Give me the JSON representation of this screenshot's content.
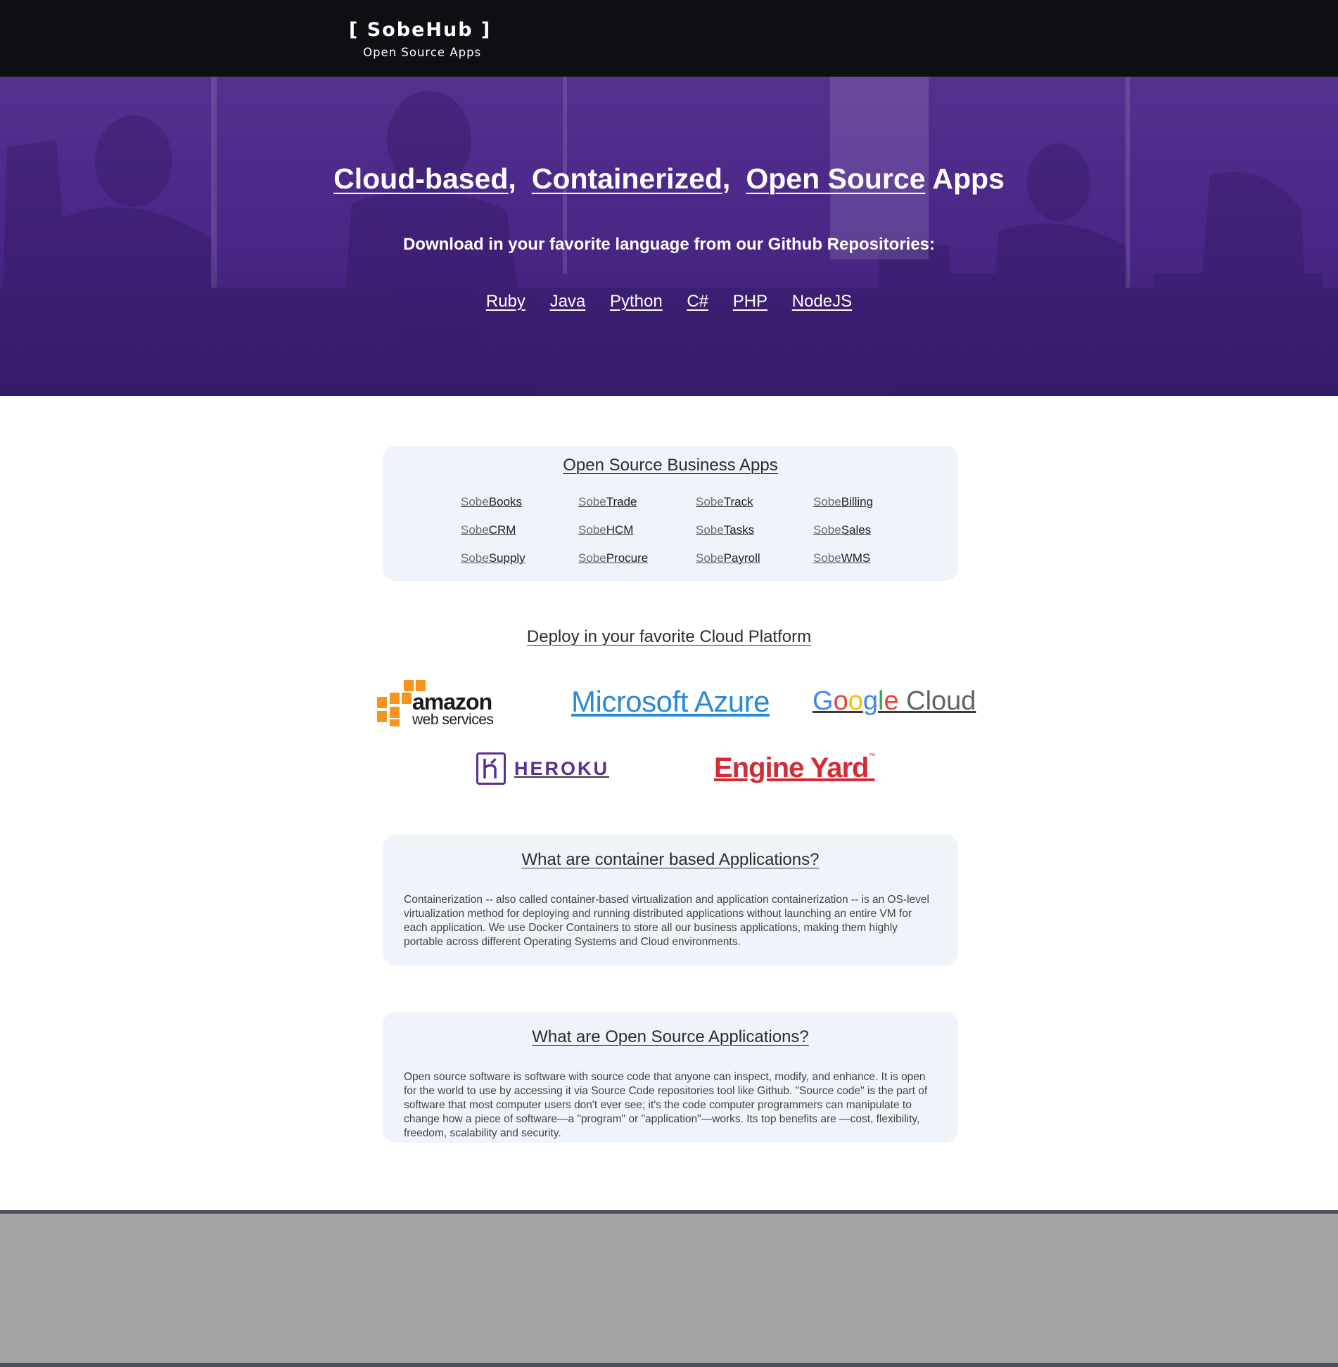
{
  "header": {
    "brand_title": "[ SobeHub ]",
    "brand_subtitle": "Open Source Apps"
  },
  "hero": {
    "title_parts": [
      "Cloud-based",
      ",",
      "Containerized",
      ",",
      "Open Source",
      "Apps"
    ],
    "subtitle": "Download in your favorite language from our Github Repositories:",
    "languages": [
      "Ruby",
      "Java",
      "Python",
      "C#",
      "PHP",
      "NodeJS"
    ]
  },
  "apps_section": {
    "title": "Open Source Business Apps",
    "prefix": "Sobe",
    "apps": [
      "Books",
      "Trade",
      "Track",
      "Billing",
      "CRM",
      "HCM",
      "Tasks",
      "Sales",
      "Supply",
      "Procure",
      "Payroll",
      "WMS"
    ]
  },
  "deploy_section": {
    "title": "Deploy in your favorite Cloud Platform",
    "platforms": {
      "aws_line1": "amazon",
      "aws_line2": "web services",
      "azure": "Microsoft Azure",
      "google_letters": [
        "G",
        "o",
        "o",
        "g",
        "l",
        "e"
      ],
      "google_suffix": "Cloud",
      "heroku": "HEROKU",
      "engine_yard": "Engine Yard",
      "engine_yard_mark": "™"
    }
  },
  "info_container": {
    "title": "What are container based Applications?",
    "body": "Containerization -- also called container-based virtualization and application containerization -- is an OS-level virtualization method for deploying and running distributed applications without launching an entire VM for each application.  We use Docker Containers to store all our business applications, making them highly portable across different Operating Systems and Cloud environments."
  },
  "info_opensource": {
    "title": "What are Open Source Applications?",
    "body": "Open source software is software with source code that anyone can inspect, modify, and enhance. It is open for the world to use by accessing it via  Source Code repositories tool like Github. \"Source code\" is the part of software that most computer users don't ever see; it's the code computer programmers can manipulate to change how a piece of software—a \"program\" or \"application\"—works. Its top benefits are —cost, flexibility, freedom, scalability and security."
  },
  "colors": {
    "header_bg": "#0e0f12",
    "hero_purple": "#4a2888",
    "card_bg": "#eff3fa",
    "footer_bg": "#a4a4a4",
    "azure_blue": "#2a8ad4",
    "heroku_purple": "#5b2e93",
    "engine_yard_red": "#d42a35",
    "aws_orange": "#f7941e"
  }
}
